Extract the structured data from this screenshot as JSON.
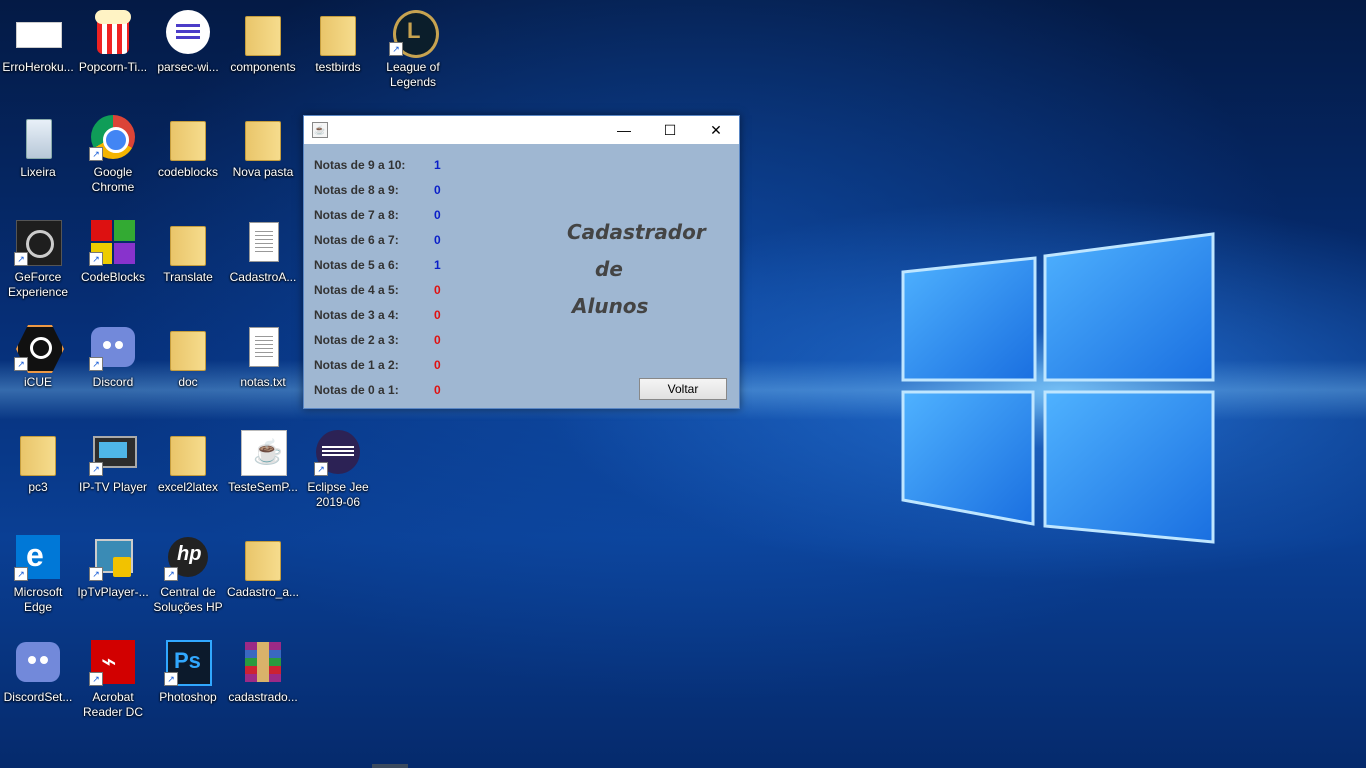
{
  "desktop": {
    "icons": [
      {
        "label": "ErroHeroku...",
        "icon": "screenshot-icon"
      },
      {
        "label": "Popcorn-Ti...",
        "icon": "popcorn-icon"
      },
      {
        "label": "parsec-wi...",
        "icon": "parsec-icon"
      },
      {
        "label": "components",
        "icon": "folder-icon"
      },
      {
        "label": "testbirds",
        "icon": "folder-icon"
      },
      {
        "label": "League of Legends",
        "icon": "league-icon"
      },
      {
        "label": "Lixeira",
        "icon": "recycle-bin-icon"
      },
      {
        "label": "Google Chrome",
        "icon": "chrome-icon"
      },
      {
        "label": "codeblocks",
        "icon": "folder-icon"
      },
      {
        "label": "Nova pasta",
        "icon": "folder-icon"
      },
      {
        "label": "GeForce Experience",
        "icon": "geforce-icon"
      },
      {
        "label": "CodeBlocks",
        "icon": "codeblocks-icon"
      },
      {
        "label": "Translate",
        "icon": "folder-icon"
      },
      {
        "label": "CadastroA...",
        "icon": "text-document-icon"
      },
      {
        "label": "iCUE",
        "icon": "icue-icon"
      },
      {
        "label": "Discord",
        "icon": "discord-icon"
      },
      {
        "label": "doc",
        "icon": "folder-icon"
      },
      {
        "label": "notas.txt",
        "icon": "text-document-icon"
      },
      {
        "label": "pc3",
        "icon": "folder-icon"
      },
      {
        "label": "IP-TV Player",
        "icon": "iptv-icon"
      },
      {
        "label": "excel2latex",
        "icon": "folder-icon"
      },
      {
        "label": "TesteSemP...",
        "icon": "java-icon"
      },
      {
        "label": "Eclipse Jee 2019-06",
        "icon": "eclipse-icon"
      },
      {
        "label": "Microsoft Edge",
        "icon": "edge-icon"
      },
      {
        "label": "IpTvPlayer-...",
        "icon": "iptv-installer-icon"
      },
      {
        "label": "Central de Soluções HP",
        "icon": "hp-icon"
      },
      {
        "label": "Cadastro_a...",
        "icon": "folder-icon"
      },
      {
        "label": "DiscordSet...",
        "icon": "discord-icon"
      },
      {
        "label": "Acrobat Reader DC",
        "icon": "acrobat-icon"
      },
      {
        "label": "Photoshop",
        "icon": "photoshop-icon"
      },
      {
        "label": "cadastrado...",
        "icon": "winrar-icon"
      }
    ]
  },
  "window": {
    "minimize": "—",
    "maximize": "☐",
    "close": "✕",
    "rows": [
      {
        "label": "Notas de 9 a 10:",
        "count": "1",
        "color": "#0a1ec8"
      },
      {
        "label": "Notas de 8 a 9:",
        "count": "0",
        "color": "#0a1ec8"
      },
      {
        "label": "Notas de 7 a 8:",
        "count": "0",
        "color": "#0a1ec8"
      },
      {
        "label": "Notas de 6 a 7:",
        "count": "0",
        "color": "#0a1ec8"
      },
      {
        "label": "Notas de 5 a 6:",
        "count": "1",
        "color": "#0a1ec8"
      },
      {
        "label": "Notas de 4 a 5:",
        "count": "0",
        "color": "#e01010"
      },
      {
        "label": "Notas de 3 a 4:",
        "count": "0",
        "color": "#e01010"
      },
      {
        "label": "Notas de 2 a 3:",
        "count": "0",
        "color": "#e01010"
      },
      {
        "label": "Notas de 1 a 2:",
        "count": "0",
        "color": "#e01010"
      },
      {
        "label": "Notas de 0 a 1:",
        "count": "0",
        "color": "#e01010"
      }
    ],
    "brand_line1": "Cadastrador",
    "brand_line2": "de",
    "brand_line3": "Alunos",
    "voltar_label": "Voltar"
  }
}
